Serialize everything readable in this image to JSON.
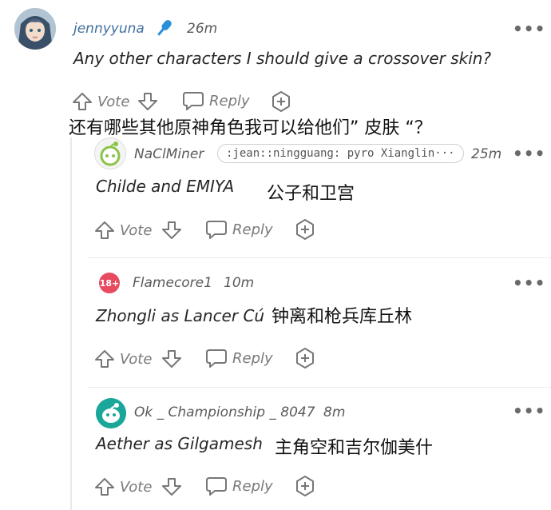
{
  "post": {
    "username": "jennyyuna",
    "time": "26m",
    "text": "Any other characters I should give a crossover skin?",
    "translation": "还有哪些其他原神角色我可以给他们” 皮肤 “？",
    "vote_label": "Vote",
    "reply_label": "Reply"
  },
  "replies": [
    {
      "username": "NaClMiner",
      "flair": ":jean::ningguang: pyro Xianglin···",
      "time": "25m",
      "text": "Childe and EMIYA",
      "translation": "公子和卫宫",
      "vote_label": "Vote",
      "reply_label": "Reply"
    },
    {
      "username": "Flamecore1",
      "badge": "18+",
      "time": "10m",
      "text": "Zhongli as Lancer Cú",
      "translation": "钟离和枪兵库丘林",
      "vote_label": "Vote",
      "reply_label": "Reply"
    },
    {
      "username": "Ok _ Championship _ 8047",
      "time": "8m",
      "text": "Aether as Gilgamesh",
      "translation": "主角空和吉尔伽美什",
      "vote_label": "Vote",
      "reply_label": "Reply"
    }
  ],
  "more_label": "•••",
  "colors": {
    "nsfw_badge": "#e84a5f",
    "mic_icon": "#2a8fd8",
    "snoo_avatar_green": "#8bc34a",
    "snoo_avatar_teal": "#1aa79a"
  }
}
